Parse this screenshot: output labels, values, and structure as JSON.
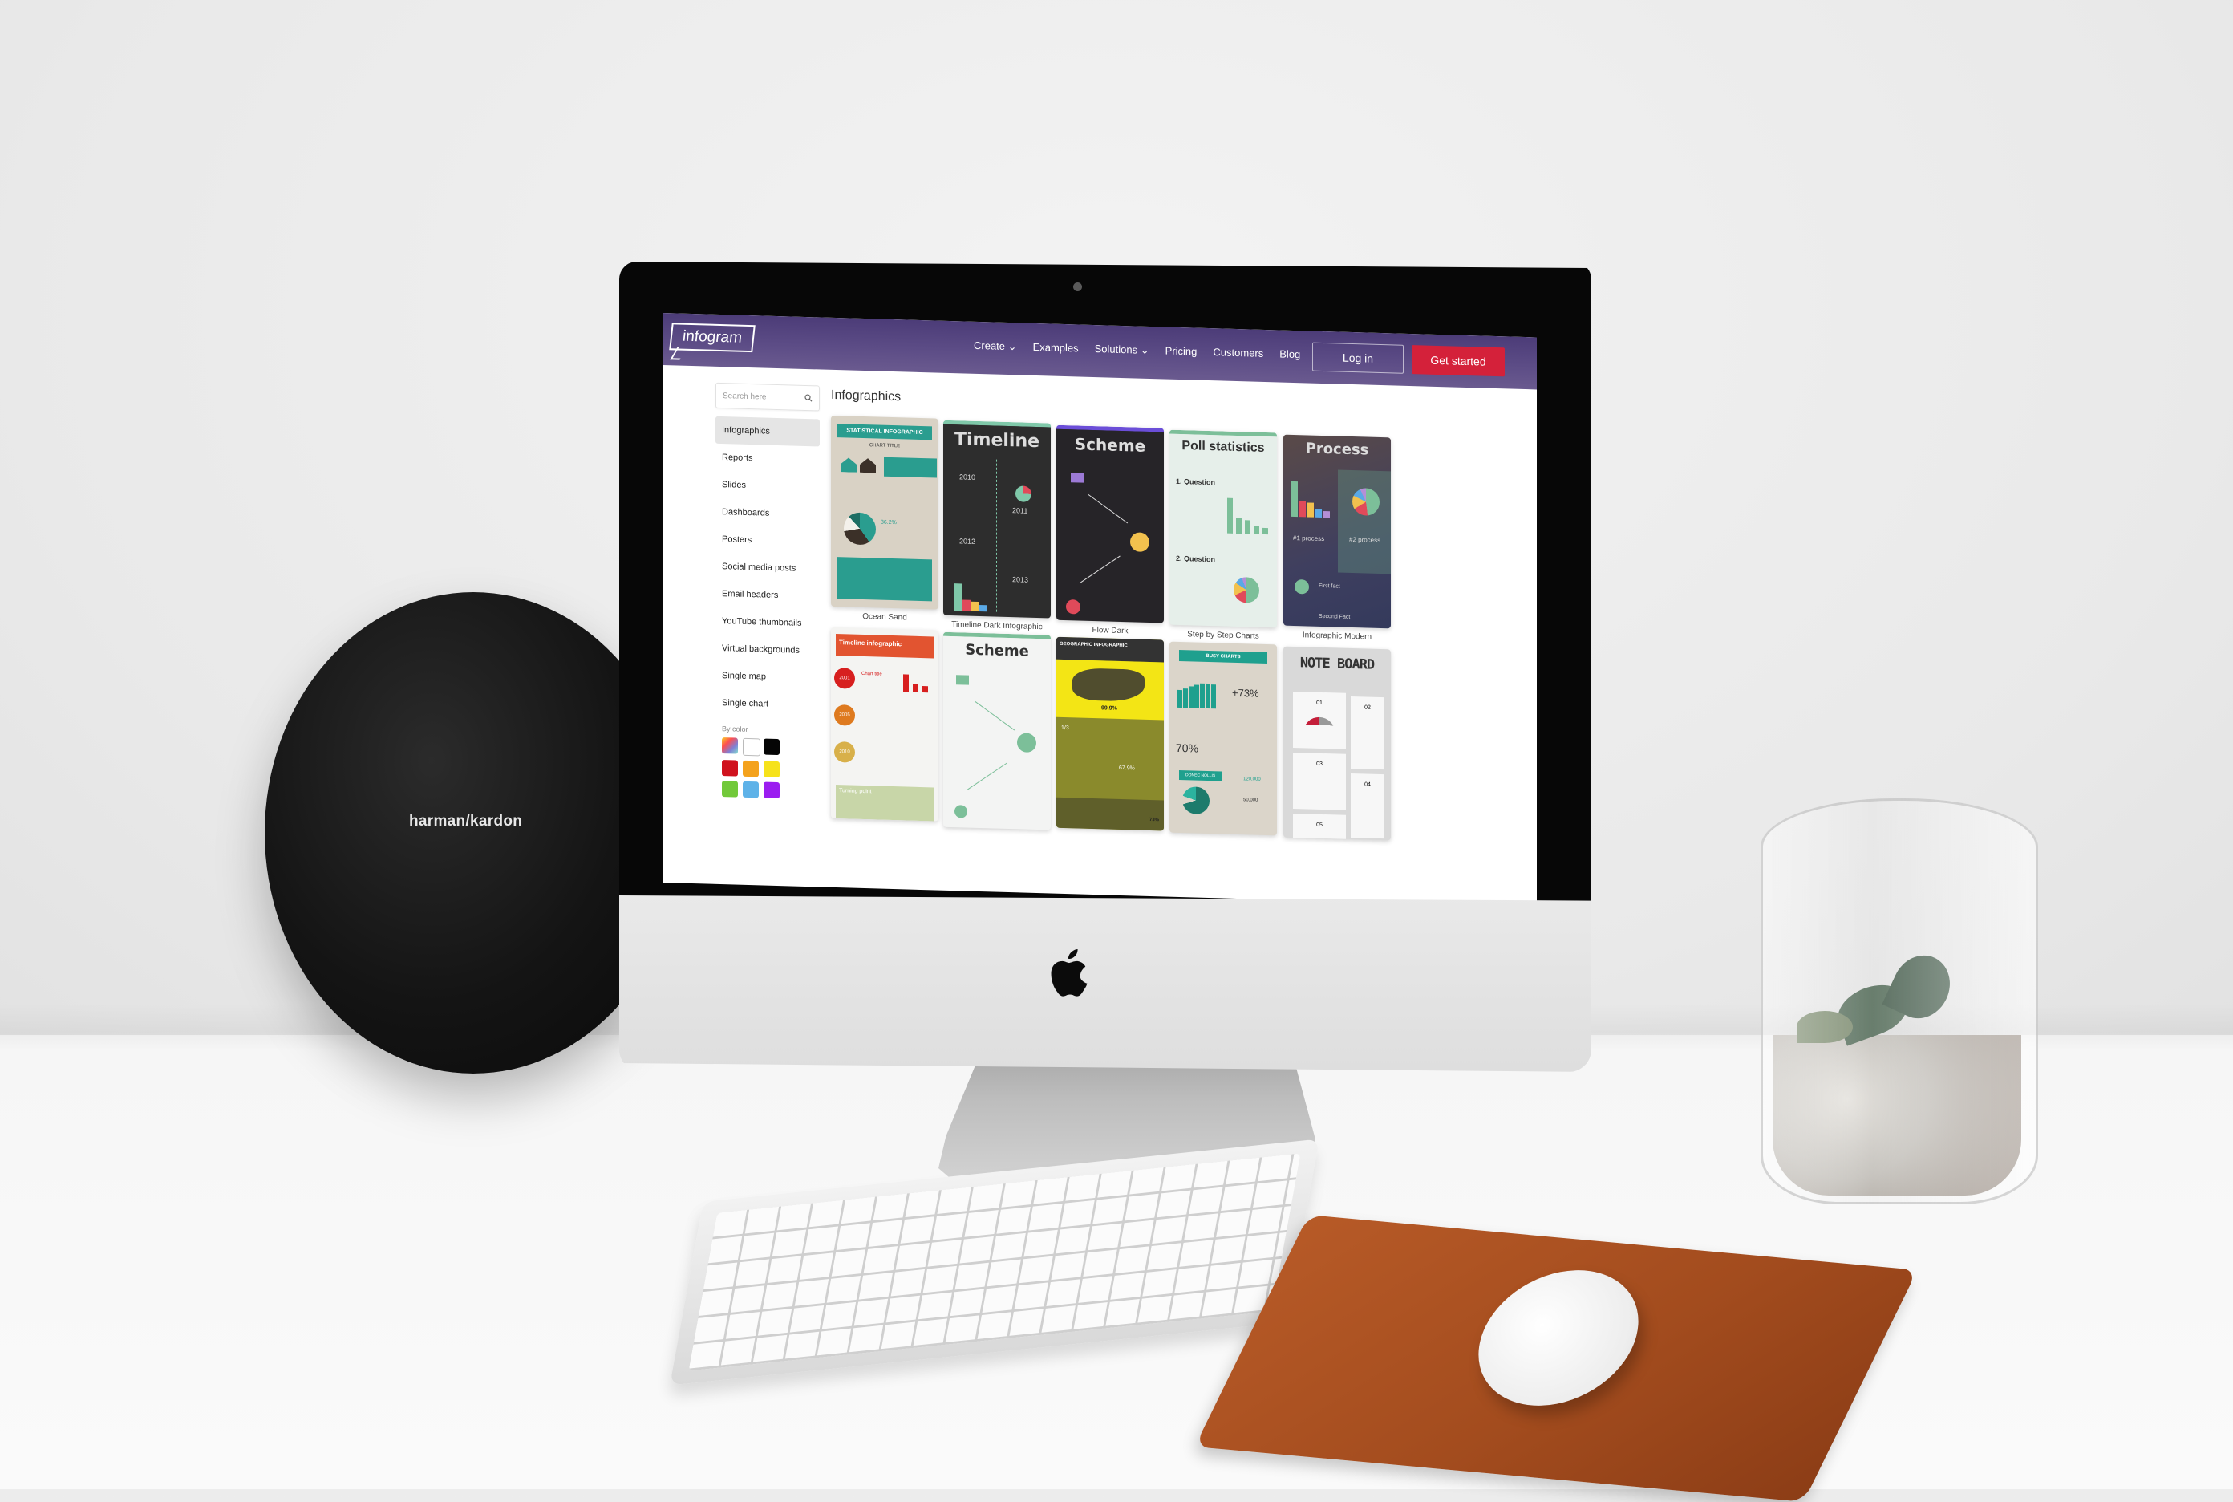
{
  "scene": {
    "speaker_brand": "harman/kardon"
  },
  "app": {
    "logo_text": "infogram",
    "nav": [
      {
        "label": "Create",
        "has_dropdown": true
      },
      {
        "label": "Examples",
        "has_dropdown": false
      },
      {
        "label": "Solutions",
        "has_dropdown": true
      },
      {
        "label": "Pricing",
        "has_dropdown": false
      },
      {
        "label": "Customers",
        "has_dropdown": false
      },
      {
        "label": "Blog",
        "has_dropdown": false
      }
    ],
    "chevron": "⌄",
    "login_label": "Log in",
    "get_started_label": "Get started",
    "colors": {
      "topbar": "#55457f",
      "accent_red": "#d4213a"
    }
  },
  "sidebar": {
    "search_placeholder": "Search here",
    "items": [
      {
        "label": "Infographics",
        "active": true
      },
      {
        "label": "Reports"
      },
      {
        "label": "Slides"
      },
      {
        "label": "Dashboards"
      },
      {
        "label": "Posters"
      },
      {
        "label": "Social media posts"
      },
      {
        "label": "Email headers"
      },
      {
        "label": "YouTube thumbnails"
      },
      {
        "label": "Virtual backgrounds"
      },
      {
        "label": "Single map"
      },
      {
        "label": "Single chart"
      }
    ],
    "by_color_label": "By color",
    "swatches": [
      {
        "name": "multicolor",
        "color": "linear-gradient(135deg,#f9d423,#ff4e50,#7f7fd5,#86e3ce)"
      },
      {
        "name": "white",
        "color": "#ffffff"
      },
      {
        "name": "black",
        "color": "#050505"
      },
      {
        "name": "red",
        "color": "#d0121e"
      },
      {
        "name": "orange",
        "color": "#f4a21c"
      },
      {
        "name": "yellow",
        "color": "#f6e21b"
      },
      {
        "name": "green",
        "color": "#72c93a"
      },
      {
        "name": "blue",
        "color": "#5eb2e8"
      },
      {
        "name": "purple",
        "color": "#9b1df0"
      }
    ]
  },
  "main": {
    "title": "Infographics",
    "templates": [
      {
        "label": "Ocean Sand",
        "heading": "STATISTICAL INFOGRAPHIC",
        "sub": "CHART TITLE",
        "stat": "36.2%"
      },
      {
        "label": "Timeline Dark Infographic",
        "heading": "Timeline",
        "years": [
          "2010",
          "2011",
          "2012",
          "2013"
        ]
      },
      {
        "label": "Flow Dark",
        "heading": "Scheme"
      },
      {
        "label": "Step by Step Charts",
        "heading": "Poll statistics",
        "q1": "1. Question",
        "q2": "2. Question"
      },
      {
        "label": "Infographic Modern",
        "heading": "Process",
        "p1": "#1 process",
        "p2": "#2 process",
        "f1": "First fact",
        "f2": "Second Fact"
      },
      {
        "label": "",
        "heading": "Timeline infographic",
        "years": [
          "2001",
          "2005",
          "2010"
        ],
        "chart_title": "Chart title",
        "footer": "Turning point"
      },
      {
        "label": "",
        "heading": "Scheme"
      },
      {
        "label": "",
        "heading": "GEOGRAPHIC INFOGRAPHIC",
        "stat1": "99.9%",
        "stat2": "1/3",
        "stat3": "67.9%",
        "stat4": "73%"
      },
      {
        "label": "",
        "heading": "BUSY CHARTS",
        "stat1": "+73%",
        "stat2": "70%",
        "ribbon": "DONEC NOLLIS",
        "n1": "120,000",
        "n2": "50,000"
      },
      {
        "label": "",
        "heading": "NOTE BOARD",
        "notes": [
          "01",
          "02",
          "03",
          "04",
          "05"
        ]
      }
    ]
  }
}
